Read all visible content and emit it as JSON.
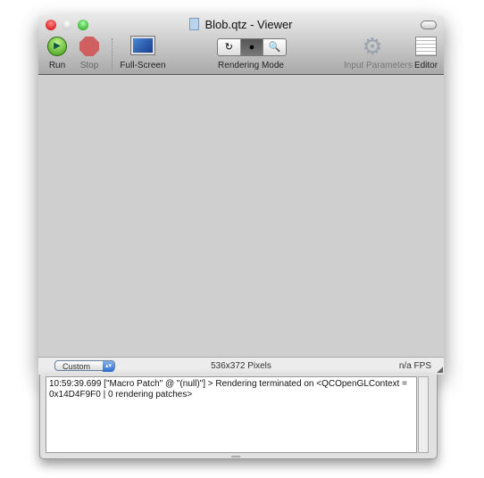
{
  "window": {
    "title": "Blob.qtz - Viewer"
  },
  "toolbar": {
    "run": "Run",
    "stop": "Stop",
    "fullscreen": "Full-Screen",
    "rendering_mode": "Rendering Mode",
    "rendering_mode_options": [
      "↻",
      "●",
      "🔍"
    ],
    "input_parameters": "Input Parameters",
    "editor": "Editor"
  },
  "status": {
    "size_preset": "Custom",
    "pixels": "536x372 Pixels",
    "fps": "n/a FPS"
  },
  "log": {
    "text": "10:59:39.699 [\"Macro Patch\" @ \"(null)\"] > Rendering terminated on <QCOpenGLContext = 0x14D4F9F0 | 0 rendering patches>"
  }
}
